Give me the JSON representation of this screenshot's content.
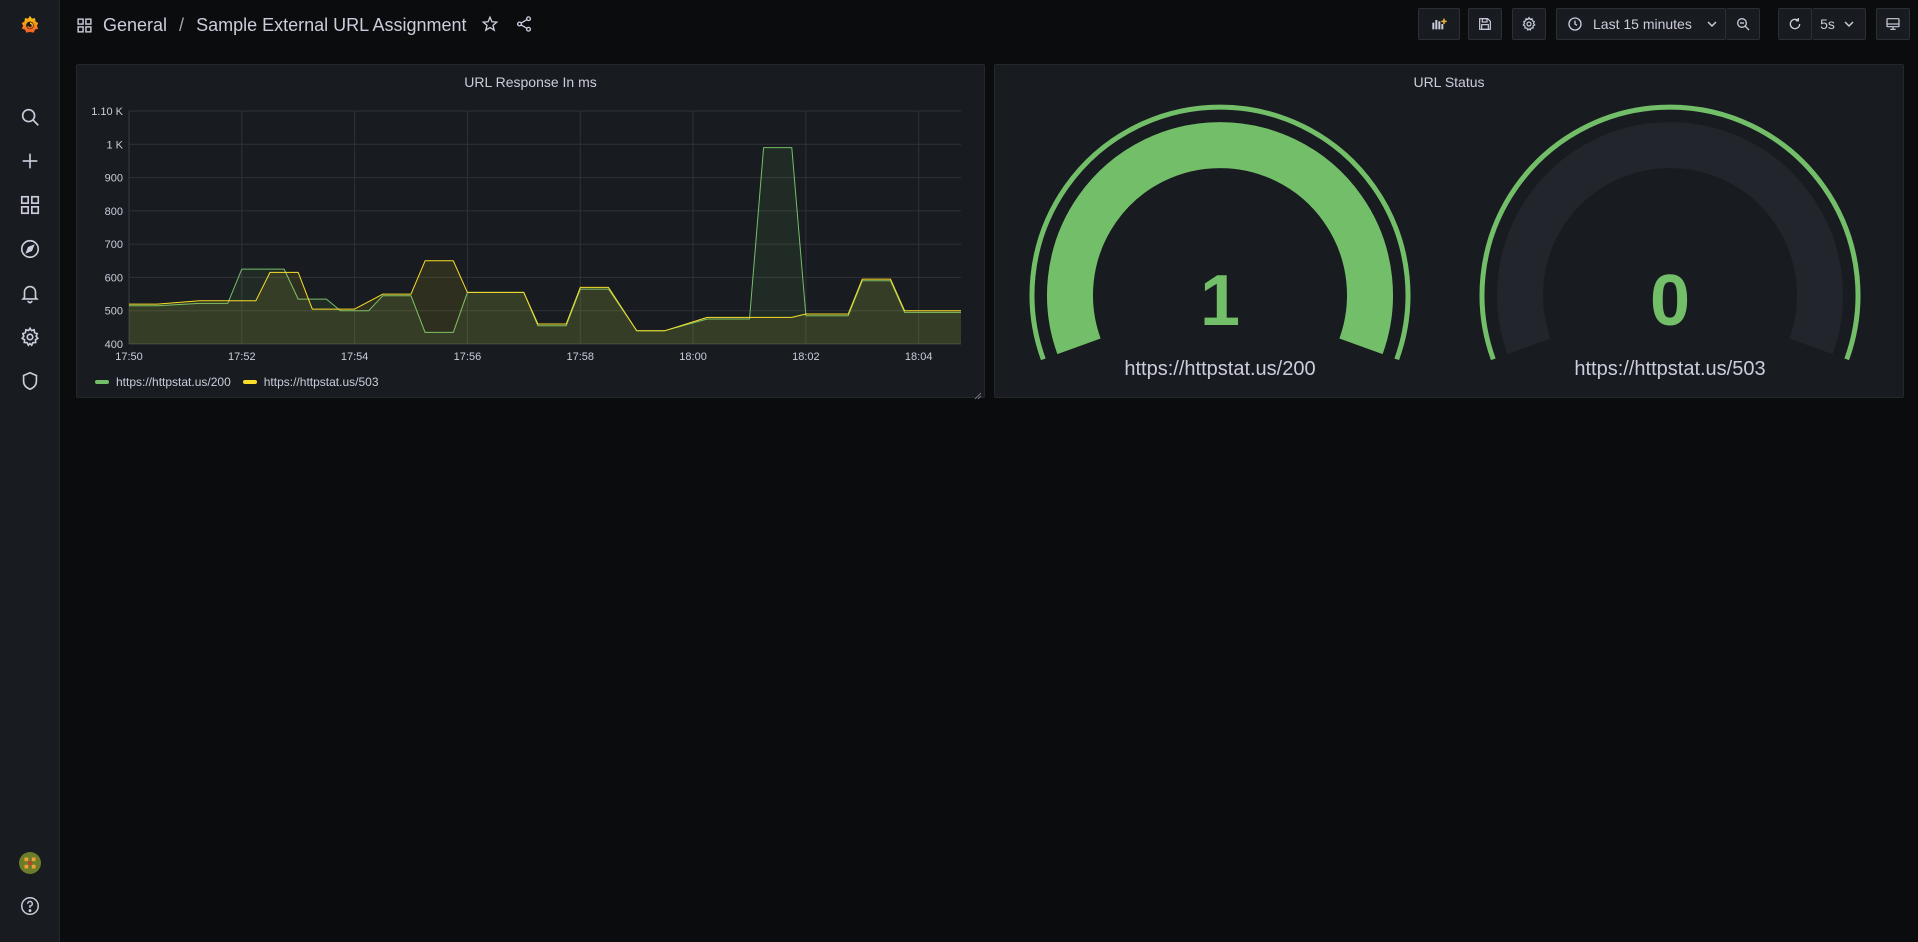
{
  "breadcrumb": {
    "folder": "General",
    "separator": "/",
    "title": "Sample External URL Assignment"
  },
  "toolbar": {
    "time_range": "Last 15 minutes",
    "refresh_interval": "5s"
  },
  "sidebar": {
    "items": [
      "search",
      "create",
      "dashboards",
      "explore",
      "alerting",
      "configuration",
      "server-admin"
    ],
    "bottom": [
      "profile",
      "help"
    ]
  },
  "colors": {
    "green": "#73bf69",
    "yellow": "#fade2a",
    "grafana_orange": "#f05a28",
    "panel_bg": "#181b1f",
    "page_bg": "#0b0c0e"
  },
  "panels": {
    "graph": {
      "title": "URL Response In ms",
      "legend": [
        {
          "label": "https://httpstat.us/200",
          "color": "#73bf69"
        },
        {
          "label": "https://httpstat.us/503",
          "color": "#fade2a"
        }
      ]
    },
    "status": {
      "title": "URL Status",
      "gauges": [
        {
          "value": "1",
          "label": "https://httpstat.us/200"
        },
        {
          "value": "0",
          "label": "https://httpstat.us/503"
        }
      ]
    }
  },
  "chart_data": {
    "type": "area",
    "title": "URL Response In ms",
    "xlabel": "",
    "ylabel": "",
    "x_ticks": [
      "17:50",
      "17:52",
      "17:54",
      "17:56",
      "17:58",
      "18:00",
      "18:02",
      "18:04"
    ],
    "y_ticks": [
      "400",
      "500",
      "600",
      "700",
      "800",
      "900",
      "1 K",
      "1.10 K"
    ],
    "xlim": [
      "17:50",
      "18:04:45"
    ],
    "ylim": [
      400,
      1100
    ],
    "grid": true,
    "legend_position": "bottom-left",
    "series": [
      {
        "name": "https://httpstat.us/200",
        "color": "#73bf69",
        "points": [
          [
            "17:50:00",
            515
          ],
          [
            "17:50:30",
            515
          ],
          [
            "17:51:15",
            522
          ],
          [
            "17:51:45",
            522
          ],
          [
            "17:52:00",
            625
          ],
          [
            "17:52:15",
            625
          ],
          [
            "17:52:45",
            625
          ],
          [
            "17:53:00",
            535
          ],
          [
            "17:53:30",
            535
          ],
          [
            "17:53:45",
            500
          ],
          [
            "17:54:15",
            500
          ],
          [
            "17:54:30",
            545
          ],
          [
            "17:55:00",
            545
          ],
          [
            "17:55:15",
            435
          ],
          [
            "17:55:45",
            435
          ],
          [
            "17:56:00",
            555
          ],
          [
            "17:56:30",
            555
          ],
          [
            "17:57:00",
            555
          ],
          [
            "17:57:15",
            455
          ],
          [
            "17:57:45",
            455
          ],
          [
            "17:58:00",
            565
          ],
          [
            "17:58:30",
            565
          ],
          [
            "17:59:00",
            440
          ],
          [
            "17:59:30",
            440
          ],
          [
            "18:00:15",
            475
          ],
          [
            "18:01:00",
            475
          ],
          [
            "18:01:15",
            990
          ],
          [
            "18:01:45",
            990
          ],
          [
            "18:02:00",
            485
          ],
          [
            "18:02:45",
            485
          ],
          [
            "18:03:00",
            590
          ],
          [
            "18:03:30",
            590
          ],
          [
            "18:03:45",
            495
          ],
          [
            "18:04:00",
            495
          ],
          [
            "18:04:45",
            495
          ]
        ]
      },
      {
        "name": "https://httpstat.us/503",
        "color": "#fade2a",
        "points": [
          [
            "17:50:00",
            520
          ],
          [
            "17:50:30",
            520
          ],
          [
            "17:51:15",
            530
          ],
          [
            "17:51:45",
            530
          ],
          [
            "17:52:00",
            530
          ],
          [
            "17:52:15",
            530
          ],
          [
            "17:52:30",
            615
          ],
          [
            "17:53:00",
            615
          ],
          [
            "17:53:15",
            505
          ],
          [
            "17:53:30",
            505
          ],
          [
            "17:54:00",
            505
          ],
          [
            "17:54:30",
            550
          ],
          [
            "17:55:00",
            550
          ],
          [
            "17:55:15",
            650
          ],
          [
            "17:55:45",
            650
          ],
          [
            "17:56:00",
            555
          ],
          [
            "17:56:30",
            555
          ],
          [
            "17:57:00",
            555
          ],
          [
            "17:57:15",
            460
          ],
          [
            "17:57:45",
            460
          ],
          [
            "17:58:00",
            570
          ],
          [
            "17:58:30",
            570
          ],
          [
            "17:59:00",
            440
          ],
          [
            "17:59:30",
            440
          ],
          [
            "18:00:15",
            480
          ],
          [
            "18:01:00",
            480
          ],
          [
            "18:01:15",
            480
          ],
          [
            "18:01:45",
            480
          ],
          [
            "18:02:00",
            490
          ],
          [
            "18:02:45",
            490
          ],
          [
            "18:03:00",
            595
          ],
          [
            "18:03:30",
            595
          ],
          [
            "18:03:45",
            500
          ],
          [
            "18:04:00",
            500
          ],
          [
            "18:04:45",
            500
          ]
        ]
      }
    ]
  }
}
